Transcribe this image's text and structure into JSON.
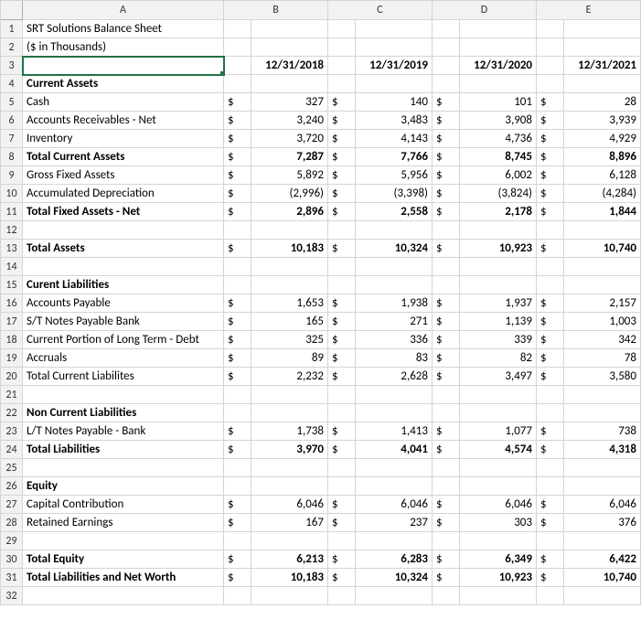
{
  "chart_data": {
    "type": "table",
    "title": "SRT Solutions Balance Sheet ($ in Thousands)",
    "columns": [
      "12/31/2018",
      "12/31/2019",
      "12/31/2020",
      "12/31/2021"
    ],
    "sections": [
      {
        "heading": "Current Assets",
        "rows": [
          {
            "label": "Cash",
            "values": [
              327,
              140,
              101,
              28
            ]
          },
          {
            "label": "Accounts Receivables - Net",
            "values": [
              3240,
              3483,
              3908,
              3939
            ]
          },
          {
            "label": "Inventory",
            "values": [
              3720,
              4143,
              4736,
              4929
            ]
          },
          {
            "label": "Total Current Assets",
            "bold": true,
            "values": [
              7287,
              7766,
              8745,
              8896
            ]
          },
          {
            "label": "Gross Fixed Assets",
            "values": [
              5892,
              5956,
              6002,
              6128
            ]
          },
          {
            "label": "Accumulated Depreciation",
            "values": [
              -2996,
              -3398,
              -3824,
              -4284
            ]
          },
          {
            "label": "Total Fixed Assets - Net",
            "bold": true,
            "values": [
              2896,
              2558,
              2178,
              1844
            ]
          }
        ]
      },
      {
        "rows": [
          {
            "label": "Total Assets",
            "bold": true,
            "values": [
              10183,
              10324,
              10923,
              10740
            ]
          }
        ]
      },
      {
        "heading": "Curent Liabilities",
        "rows": [
          {
            "label": "Accounts Payable",
            "values": [
              1653,
              1938,
              1937,
              2157
            ]
          },
          {
            "label": "S/T Notes Payable Bank",
            "values": [
              165,
              271,
              1139,
              1003
            ]
          },
          {
            "label": "Current Portion of Long Term - Debt",
            "values": [
              325,
              336,
              339,
              342
            ]
          },
          {
            "label": "Accruals",
            "values": [
              89,
              83,
              82,
              78
            ]
          },
          {
            "label": "Total Current Liabilites",
            "values": [
              2232,
              2628,
              3497,
              3580
            ]
          }
        ]
      },
      {
        "heading": "Non Current Liabilities",
        "rows": [
          {
            "label": "L/T Notes Payable - Bank",
            "values": [
              1738,
              1413,
              1077,
              738
            ]
          },
          {
            "label": "Total Liabilities",
            "bold": true,
            "values": [
              3970,
              4041,
              4574,
              4318
            ]
          }
        ]
      },
      {
        "heading": "Equity",
        "rows": [
          {
            "label": "Capital Contribution",
            "values": [
              6046,
              6046,
              6046,
              6046
            ]
          },
          {
            "label": "Retained Earnings",
            "values": [
              167,
              237,
              303,
              376
            ]
          }
        ]
      },
      {
        "rows": [
          {
            "label": "Total Equity",
            "bold": true,
            "values": [
              6213,
              6283,
              6349,
              6422
            ]
          },
          {
            "label": "Total Liabilities and Net Worth",
            "bold": true,
            "values": [
              10183,
              10324,
              10923,
              10740
            ]
          }
        ]
      }
    ]
  },
  "ui": {
    "col_headers": [
      "A",
      "B",
      "C",
      "D",
      "E"
    ],
    "title1": "SRT Solutions Balance Sheet",
    "title2": "($ in Thousands)",
    "currency": "$",
    "selected_cell": "A3",
    "row_plan": [
      {
        "r": 1,
        "type": "text",
        "a": "title1"
      },
      {
        "r": 2,
        "type": "text",
        "a": "title2"
      },
      {
        "r": 3,
        "type": "selected_dates"
      },
      {
        "r": 4,
        "type": "header",
        "text": "Current Assets"
      },
      {
        "r": 5,
        "type": "data",
        "sec": 0,
        "row": 0
      },
      {
        "r": 6,
        "type": "data",
        "sec": 0,
        "row": 1
      },
      {
        "r": 7,
        "type": "data",
        "sec": 0,
        "row": 2
      },
      {
        "r": 8,
        "type": "data",
        "sec": 0,
        "row": 3
      },
      {
        "r": 9,
        "type": "data",
        "sec": 0,
        "row": 4
      },
      {
        "r": 10,
        "type": "data",
        "sec": 0,
        "row": 5
      },
      {
        "r": 11,
        "type": "data",
        "sec": 0,
        "row": 6
      },
      {
        "r": 12,
        "type": "blank"
      },
      {
        "r": 13,
        "type": "data",
        "sec": 1,
        "row": 0
      },
      {
        "r": 14,
        "type": "blank"
      },
      {
        "r": 15,
        "type": "header",
        "text": "Curent Liabilities"
      },
      {
        "r": 16,
        "type": "data",
        "sec": 2,
        "row": 0
      },
      {
        "r": 17,
        "type": "data",
        "sec": 2,
        "row": 1
      },
      {
        "r": 18,
        "type": "data",
        "sec": 2,
        "row": 2
      },
      {
        "r": 19,
        "type": "data",
        "sec": 2,
        "row": 3
      },
      {
        "r": 20,
        "type": "data",
        "sec": 2,
        "row": 4
      },
      {
        "r": 21,
        "type": "blank"
      },
      {
        "r": 22,
        "type": "header",
        "text": "Non Current Liabilities"
      },
      {
        "r": 23,
        "type": "data",
        "sec": 3,
        "row": 0
      },
      {
        "r": 24,
        "type": "data",
        "sec": 3,
        "row": 1
      },
      {
        "r": 25,
        "type": "blank"
      },
      {
        "r": 26,
        "type": "header",
        "text": "Equity"
      },
      {
        "r": 27,
        "type": "data",
        "sec": 4,
        "row": 0
      },
      {
        "r": 28,
        "type": "data",
        "sec": 4,
        "row": 1
      },
      {
        "r": 29,
        "type": "blank"
      },
      {
        "r": 30,
        "type": "data",
        "sec": 5,
        "row": 0
      },
      {
        "r": 31,
        "type": "data",
        "sec": 5,
        "row": 1
      },
      {
        "r": 32,
        "type": "blank"
      }
    ]
  }
}
